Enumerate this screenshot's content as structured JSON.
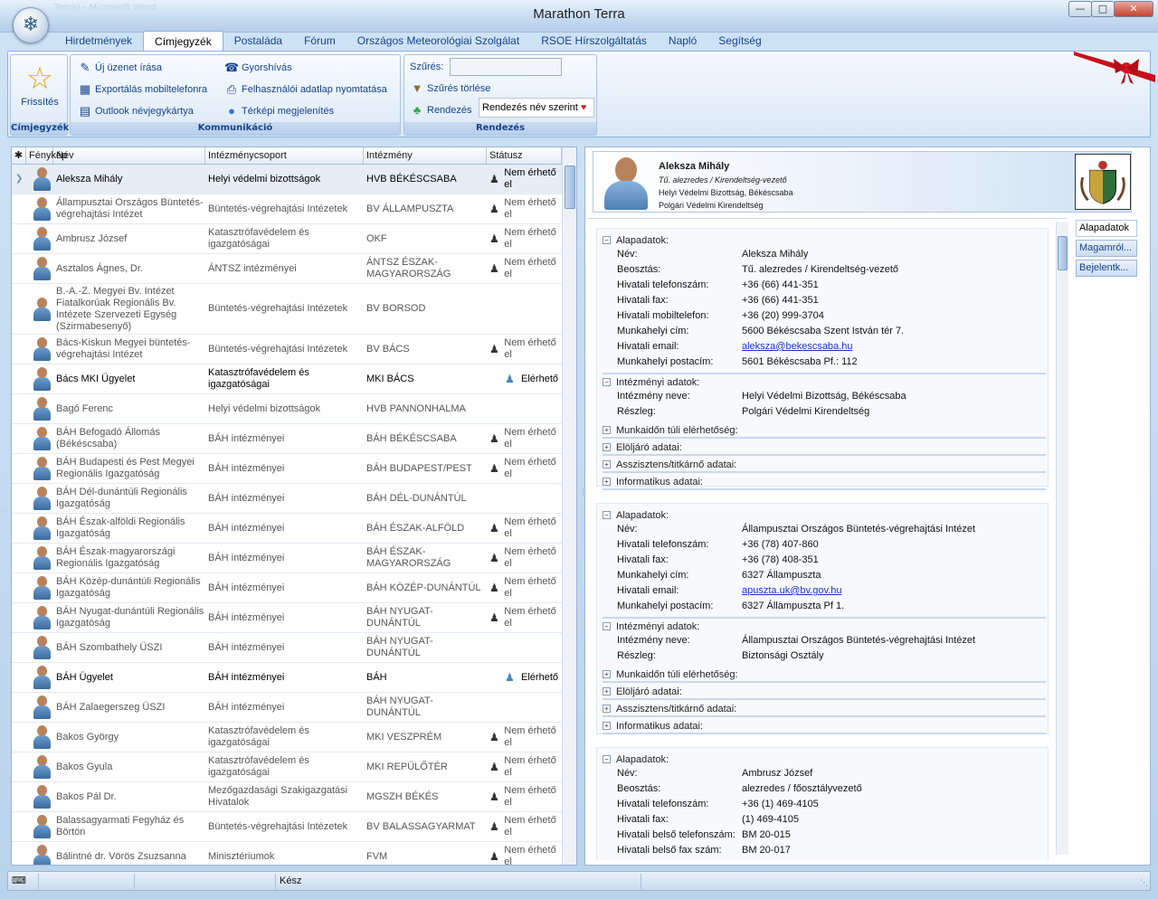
{
  "window": {
    "title": "Marathon Terra",
    "blurred_title": "Terra) - Microsoft Word"
  },
  "tabs": [
    "Hirdetmények",
    "Címjegyzék",
    "Postaláda",
    "Fórum",
    "Országos Meteorológiai Szolgálat",
    "RSOE Hírszolgáltatás",
    "Napló",
    "Segítség"
  ],
  "active_tab": "Címjegyzék",
  "ribbon": {
    "refresh": "Frissítés",
    "groups": [
      "Címjegyzék",
      "Kommunikáció",
      "Rendezés"
    ],
    "kommunikacio": {
      "new_message": "Új üzenet írása",
      "quick_call": "Gyorshívás",
      "export_mobile": "Exportálás mobiltelefonra",
      "print_user": "Felhasználói adatlap nyomtatása",
      "outlook_card": "Outlook névjegykártya",
      "map_display": "Térképi megjelenítés"
    },
    "rendezes": {
      "filter_label": "Szűrés:",
      "filter_value": "",
      "filter_clear": "Szűrés törlése",
      "sort_label": "Rendezés",
      "sort_value": "Rendezés név szerint"
    }
  },
  "grid": {
    "columns": [
      "Fénykép",
      "Név",
      "Intézménycsoport",
      "Intézmény",
      "Státusz"
    ],
    "rows": [
      {
        "name": "Aleksza Mihály",
        "group": "Helyi védelmi bizottságok",
        "inst": "HVB BÉKÉSCSABA",
        "status": "Nem érhető el",
        "bold": true,
        "selected": true
      },
      {
        "name": "Állampusztai Országos Büntetés-végrehajtási Intézet",
        "group": "Büntetés-végrehajtási Intézetek",
        "inst": "BV ÁLLAMPUSZTA",
        "status": "Nem érhető el"
      },
      {
        "name": "Ambrusz József",
        "group": "Katasztrófavédelem és igazgatóságai",
        "inst": "OKF",
        "status": "Nem érhető el"
      },
      {
        "name": "Asztalos Ágnes, Dr.",
        "group": "ÁNTSZ intézményei",
        "inst": "ÁNTSZ ÉSZAK-MAGYARORSZÁG",
        "status": "Nem érhető el"
      },
      {
        "name": "B.-A.-Z. Megyei Bv. Intézet Fiatalkorúak Regionális Bv. Intézete Szervezeti Egység (Szirmabesenyő)",
        "group": "Büntetés-végrehajtási Intézetek",
        "inst": "BV BORSOD",
        "status": ""
      },
      {
        "name": "Bács-Kiskun Megyei büntetés-végrehajtási Intézet",
        "group": "Büntetés-végrehajtási Intézetek",
        "inst": "BV BÁCS",
        "status": "Nem érhető el"
      },
      {
        "name": "Bács MKI Ügyelet",
        "group": "Katasztrófavédelem és igazgatóságai",
        "inst": "MKI BÁCS",
        "status": "Elérhető",
        "bold": true,
        "online": true
      },
      {
        "name": "Bagó Ferenc",
        "group": "Helyi védelmi bizottságok",
        "inst": "HVB PANNONHALMA",
        "status": ""
      },
      {
        "name": "BÁH Befogadó Állomás (Békéscsaba)",
        "group": "BÁH intézményei",
        "inst": "BÁH BÉKÉSCSABA",
        "status": "Nem érhető el"
      },
      {
        "name": "BÁH Budapesti és Pest Megyei Regionális Igazgatóság",
        "group": "BÁH intézményei",
        "inst": "BÁH BUDAPEST/PEST",
        "status": "Nem érhető el"
      },
      {
        "name": "BÁH Dél-dunántúli Regionális Igazgatóság",
        "group": "BÁH intézményei",
        "inst": "BÁH DÉL-DUNÁNTÚL",
        "status": ""
      },
      {
        "name": "BÁH Észak-alföldi Regionális Igazgatóság",
        "group": "BÁH intézményei",
        "inst": "BÁH ÉSZAK-ALFÖLD",
        "status": "Nem érhető el"
      },
      {
        "name": "BÁH Észak-magyarországi Regionális Igazgatóság",
        "group": "BÁH intézményei",
        "inst": "BÁH ÉSZAK-MAGYARORSZÁG",
        "status": "Nem érhető el"
      },
      {
        "name": "BÁH Közép-dunántúli Regionális Igazgatóság",
        "group": "BÁH intézményei",
        "inst": "BÁH KÖZÉP-DUNÁNTÚL",
        "status": "Nem érhető el"
      },
      {
        "name": "BÁH Nyugat-dunántúli Regionális Igazgatóság",
        "group": "BÁH intézményei",
        "inst": "BÁH NYUGAT-DUNÁNTÚL",
        "status": "Nem érhető el"
      },
      {
        "name": "BÁH Szombathely ÜSZI",
        "group": "BÁH intézményei",
        "inst": "BÁH NYUGAT-DUNÁNTÚL",
        "status": ""
      },
      {
        "name": "BÁH Ügyelet",
        "group": "BÁH intézményei",
        "inst": "BÁH",
        "status": "Elérhető",
        "bold": true,
        "online": true
      },
      {
        "name": "BÁH Zalaegerszeg ÜSZI",
        "group": "BÁH intézményei",
        "inst": "BÁH NYUGAT-DUNÁNTÚL",
        "status": ""
      },
      {
        "name": "Bakos György",
        "group": "Katasztrófavédelem és igazgatóságai",
        "inst": "MKI VESZPRÉM",
        "status": "Nem érhető el"
      },
      {
        "name": "Bakos Gyula",
        "group": "Katasztrófavédelem és igazgatóságai",
        "inst": "MKI REPÜLŐTÉR",
        "status": "Nem érhető el"
      },
      {
        "name": "Bakos Pál Dr.",
        "group": "Mezőgazdasági Szakigazgatási Hivatalok",
        "inst": "MGSZH BÉKÉS",
        "status": "Nem érhető el"
      },
      {
        "name": "Balassagyarmati Fegyház és Börtön",
        "group": "Büntetés-végrehajtási Intézetek",
        "inst": "BV BALASSAGYARMAT",
        "status": "Nem érhető el"
      },
      {
        "name": "Bálintné dr. Vörös Zsuzsanna",
        "group": "Minisztériumok",
        "inst": "FVM",
        "status": "Nem érhető el"
      }
    ]
  },
  "detail": {
    "header": {
      "name": "Aleksza Mihály",
      "title": "Tű. alezredes / Kirendeltség-vezető",
      "org": "Helyi Védelmi Bizottság, Békéscsaba",
      "unit": "Polgári Védelmi Kirendeltség"
    },
    "side_tabs": [
      "Alapadatok",
      "Magamról...",
      "Bejelentk..."
    ],
    "section_titles": {
      "basic": "Alapadatok:",
      "inst": "Intézményi adatok:",
      "after_hours": "Munkaidőn túli elérhetőség:",
      "superior": "Elöljáró adatai:",
      "assistant": "Asszisztens/titkárnő adatai:",
      "it": "Informatikus adatai:"
    },
    "cards": [
      {
        "basic": [
          [
            "Név:",
            "Aleksza Mihály"
          ],
          [
            "Beosztás:",
            "Tű. alezredes / Kirendeltség-vezető"
          ],
          [
            "Hivatali telefonszám:",
            "+36 (66) 441-351"
          ],
          [
            "Hivatali fax:",
            "+36 (66) 441-351"
          ],
          [
            "Hivatali mobiltelefon:",
            "+36 (20) 999-3704"
          ],
          [
            "Munkahelyi cím:",
            "5600 Békéscsaba Szent István tér 7."
          ],
          [
            "Hivatali email:",
            "aleksza@bekescsaba.hu"
          ],
          [
            "Munkahelyi postacím:",
            "5601 Békéscsaba  Pf.: 112"
          ]
        ],
        "inst": [
          [
            "Intézmény neve:",
            "Helyi Védelmi Bizottság, Békéscsaba"
          ],
          [
            "Részleg:",
            "Polgári Védelmi Kirendeltség"
          ]
        ]
      },
      {
        "basic": [
          [
            "Név:",
            "Állampusztai Országos Büntetés-végrehajtási Intézet"
          ],
          [
            "Hivatali telefonszám:",
            "+36 (78) 407-860"
          ],
          [
            "Hivatali fax:",
            "+36 (78) 408-351"
          ],
          [
            "Munkahelyi cím:",
            "6327 Állampuszta"
          ],
          [
            "Hivatali email:",
            "apuszta.uk@bv.gov.hu"
          ],
          [
            "Munkahelyi postacím:",
            "6327 Állampuszta Pf 1."
          ]
        ],
        "inst": [
          [
            "Intézmény neve:",
            "Állampusztai Országos Büntetés-végrehajtási Intézet"
          ],
          [
            "Részleg:",
            "Biztonsági Osztály"
          ]
        ]
      },
      {
        "basic": [
          [
            "Név:",
            "Ambrusz József"
          ],
          [
            "Beosztás:",
            "alezredes / főosztályvezető"
          ],
          [
            "Hivatali telefonszám:",
            "+36 (1) 469-4105"
          ],
          [
            "Hivatali fax:",
            "(1) 469-4105"
          ],
          [
            "Hivatali belső telefonszám:",
            "BM 20-015"
          ],
          [
            "Hivatali belső fax szám:",
            "BM 20-017"
          ]
        ]
      }
    ]
  },
  "statusbar": {
    "status": "Kész"
  },
  "colors": {
    "accent": "#15428b",
    "link": "#1a33c8",
    "online": "#4a86c5"
  }
}
